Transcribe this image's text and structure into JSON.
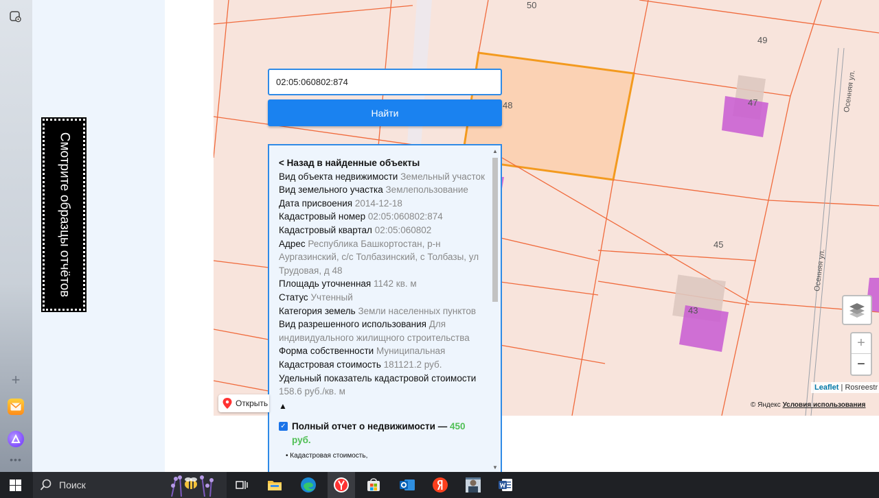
{
  "search": {
    "query": "02:05:060802:874",
    "find_label": "Найти"
  },
  "side_badge": {
    "text": "Смотрите образцы отчётов"
  },
  "info": {
    "back_label": "< Назад в найденные объекты",
    "rows": [
      {
        "label": "Вид объекта недвижимости",
        "value": "Земельный участок"
      },
      {
        "label": "Вид земельного участка",
        "value": "Землепользование"
      },
      {
        "label": "Дата присвоения",
        "value": "2014-12-18"
      },
      {
        "label": "Кадастровый номер",
        "value": "02:05:060802:874"
      },
      {
        "label": "Кадастровый квартал",
        "value": "02:05:060802"
      },
      {
        "label": "Адрес",
        "value": "Республика Башкортостан, р-н Аургазинский, с/с Толбазинский, с Толбазы, ул Трудовая, д 48"
      },
      {
        "label": "Площадь уточненная",
        "value": "1142 кв. м"
      },
      {
        "label": "Статус",
        "value": "Учтенный"
      },
      {
        "label": "Категория земель",
        "value": "Земли населенных пунктов"
      },
      {
        "label": "Вид разрешенного использования",
        "value": "Для индивидуального жилищного строительства"
      },
      {
        "label": "Форма собственности",
        "value": "Муниципальная"
      },
      {
        "label": "Кадастровая стоимость",
        "value": "181121.2 руб."
      },
      {
        "label": "Удельный показатель кадастровой стоимости",
        "value": "158.6 руб./кв. м"
      }
    ],
    "collapse_arrow": "▲",
    "report": {
      "title": "Полный отчет о недвижимости — ",
      "price": "450 руб.",
      "bullet": "Кадастровая стоимость,"
    }
  },
  "map": {
    "labels": {
      "p50": "50",
      "p49": "49",
      "p48": "48",
      "p47": "47",
      "p45": "45",
      "p43": "43"
    },
    "streets": {
      "osennyaya_top": "Осенняя ул.",
      "osennyaya_bottom": "Осенняя ул."
    },
    "open_label": "Открыть",
    "attribution_leaflet": "Leaflet",
    "attribution_sep": " | ",
    "attribution_source": "Rosreestr",
    "terms_prefix": "© Яндекс ",
    "terms_link": "Условия использования",
    "colors": {
      "parcel_line": "#f06a3c",
      "selected_parcel": "#f39a1e",
      "building": "#c85ad2"
    }
  },
  "taskbar": {
    "search_placeholder": "Поиск"
  }
}
